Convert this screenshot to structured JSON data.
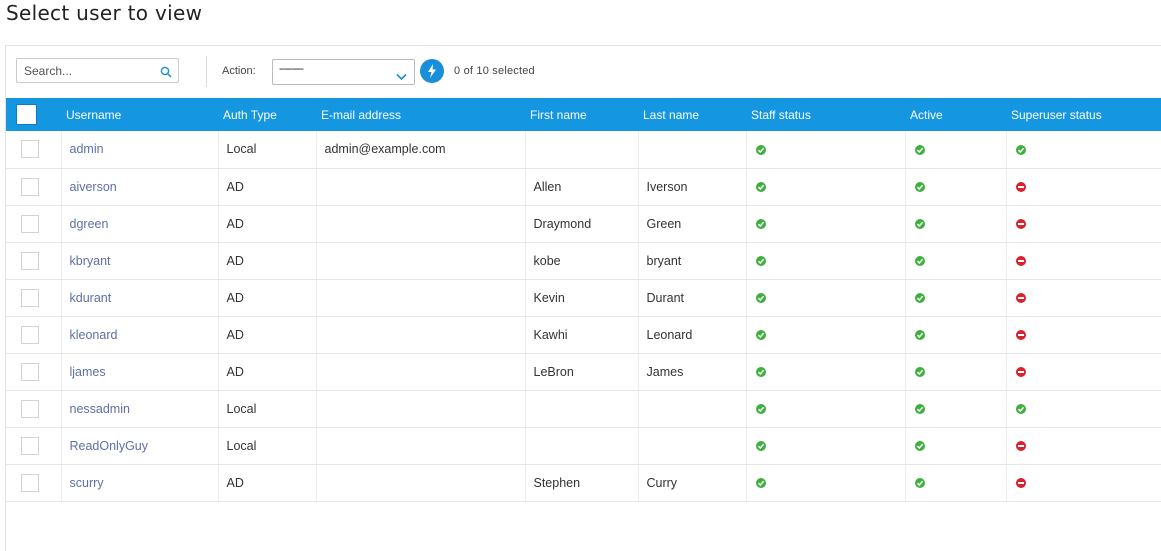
{
  "page": {
    "title": "Select user to view"
  },
  "toolbar": {
    "search_placeholder": "Search...",
    "action_label": "Action:",
    "action_selected": "---------",
    "selection_count": "0 of 10 selected"
  },
  "table": {
    "columns": [
      "Username",
      "Auth Type",
      "E-mail address",
      "First name",
      "Last name",
      "Staff status",
      "Active",
      "Superuser status"
    ],
    "rows": [
      {
        "username": "admin",
        "auth_type": "Local",
        "email": "admin@example.com",
        "first_name": "",
        "last_name": "",
        "staff": true,
        "active": true,
        "superuser": true
      },
      {
        "username": "aiverson",
        "auth_type": "AD",
        "email": "",
        "first_name": "Allen",
        "last_name": "Iverson",
        "staff": true,
        "active": true,
        "superuser": false
      },
      {
        "username": "dgreen",
        "auth_type": "AD",
        "email": "",
        "first_name": "Draymond",
        "last_name": "Green",
        "staff": true,
        "active": true,
        "superuser": false
      },
      {
        "username": "kbryant",
        "auth_type": "AD",
        "email": "",
        "first_name": "kobe",
        "last_name": "bryant",
        "staff": true,
        "active": true,
        "superuser": false
      },
      {
        "username": "kdurant",
        "auth_type": "AD",
        "email": "",
        "first_name": "Kevin",
        "last_name": "Durant",
        "staff": true,
        "active": true,
        "superuser": false
      },
      {
        "username": "kleonard",
        "auth_type": "AD",
        "email": "",
        "first_name": "Kawhi",
        "last_name": "Leonard",
        "staff": true,
        "active": true,
        "superuser": false
      },
      {
        "username": "ljames",
        "auth_type": "AD",
        "email": "",
        "first_name": "LeBron",
        "last_name": "James",
        "staff": true,
        "active": true,
        "superuser": false
      },
      {
        "username": "nessadmin",
        "auth_type": "Local",
        "email": "",
        "first_name": "",
        "last_name": "",
        "staff": true,
        "active": true,
        "superuser": true
      },
      {
        "username": "ReadOnlyGuy",
        "auth_type": "Local",
        "email": "",
        "first_name": "",
        "last_name": "",
        "staff": true,
        "active": true,
        "superuser": false
      },
      {
        "username": "scurry",
        "auth_type": "AD",
        "email": "",
        "first_name": "Stephen",
        "last_name": "Curry",
        "staff": true,
        "active": true,
        "superuser": false
      }
    ]
  },
  "icons": {
    "search": "search-icon",
    "dropdown": "chevron-down-icon",
    "action_go": "lightning-bolt-icon",
    "status_true": "check-circle-icon",
    "status_false": "minus-circle-icon"
  },
  "colors": {
    "header": "#1496e1",
    "accent": "#1a8fd9",
    "link": "#5f6fa7",
    "status_true": "#3fb03e",
    "status_false": "#d9232c"
  }
}
